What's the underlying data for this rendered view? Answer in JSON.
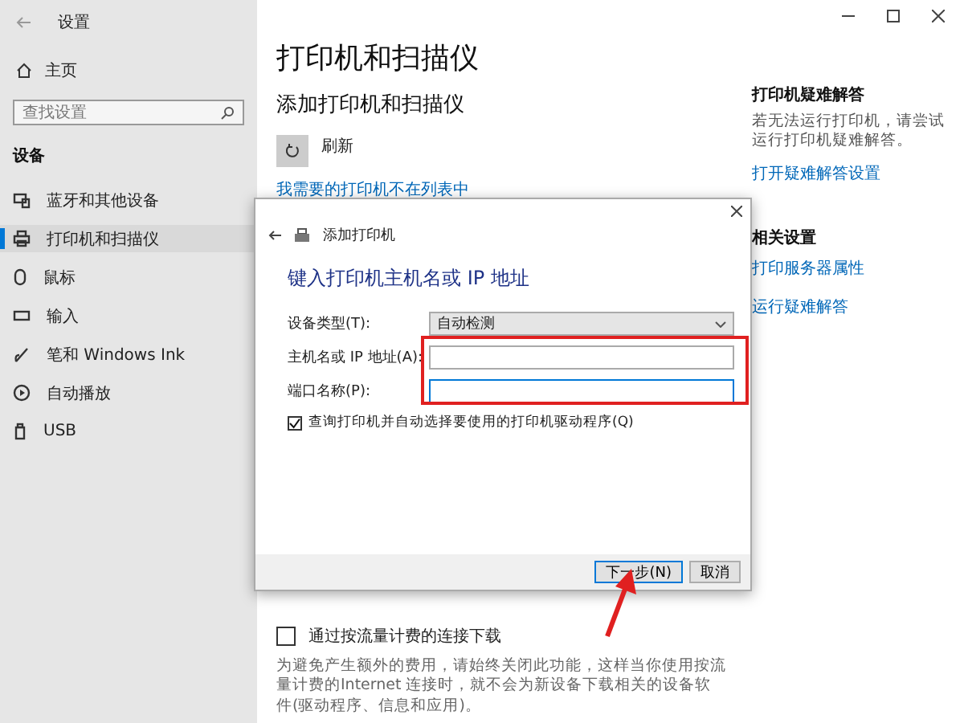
{
  "window": {
    "title": "设置"
  },
  "sidebar": {
    "home": "主页",
    "search": {
      "placeholder": "查找设置"
    },
    "section": "设备",
    "items": [
      {
        "label": "蓝牙和其他设备",
        "kind": "bluetooth",
        "selected": false
      },
      {
        "label": "打印机和扫描仪",
        "kind": "printer",
        "selected": true
      },
      {
        "label": "鼠标",
        "kind": "mouse",
        "selected": false
      },
      {
        "label": "输入",
        "kind": "keyboard",
        "selected": false
      },
      {
        "label": "笔和 Windows Ink",
        "kind": "pen",
        "selected": false
      },
      {
        "label": "自动播放",
        "kind": "autoplay",
        "selected": false
      },
      {
        "label": "USB",
        "kind": "usb",
        "selected": false
      }
    ]
  },
  "main": {
    "title": "打印机和扫描仪",
    "subtitle": "添加打印机和扫描仪",
    "refresh": "刷新",
    "link": "我需要的打印机不在列表中",
    "metered": {
      "label": "通过按流量计费的连接下载",
      "checked": false,
      "description": "为避免产生额外的费用，请始终关闭此功能，这样当你使用按流量计费的Internet 连接时，就不会为新设备下载相关的设备软件(驱动程序、信息和应用)。"
    }
  },
  "right": {
    "troubleshoot": {
      "heading": "打印机疑难解答",
      "description": "若无法运行打印机，请尝试运行打印机疑难解答。",
      "link": "打开疑难解答设置"
    },
    "related": {
      "heading": "相关设置",
      "links": [
        "打印服务器属性",
        "运行疑难解答"
      ]
    }
  },
  "dialog": {
    "title": "添加打印机",
    "heading": "键入打印机主机名或 IP 地址",
    "fields": [
      {
        "kind": "select",
        "label": "设备类型(T):",
        "value": "自动检测",
        "focused": false
      },
      {
        "kind": "text",
        "label": "主机名或 IP 地址(A):",
        "focused": false
      },
      {
        "kind": "text",
        "label": "端口名称(P):",
        "focused": true
      }
    ],
    "query": {
      "label": "查询打印机并自动选择要使用的打印机驱动程序(Q)",
      "checked": true
    },
    "buttons": [
      {
        "label": "下一步(N)",
        "primary": true
      },
      {
        "label": "取消",
        "primary": false
      }
    ]
  }
}
